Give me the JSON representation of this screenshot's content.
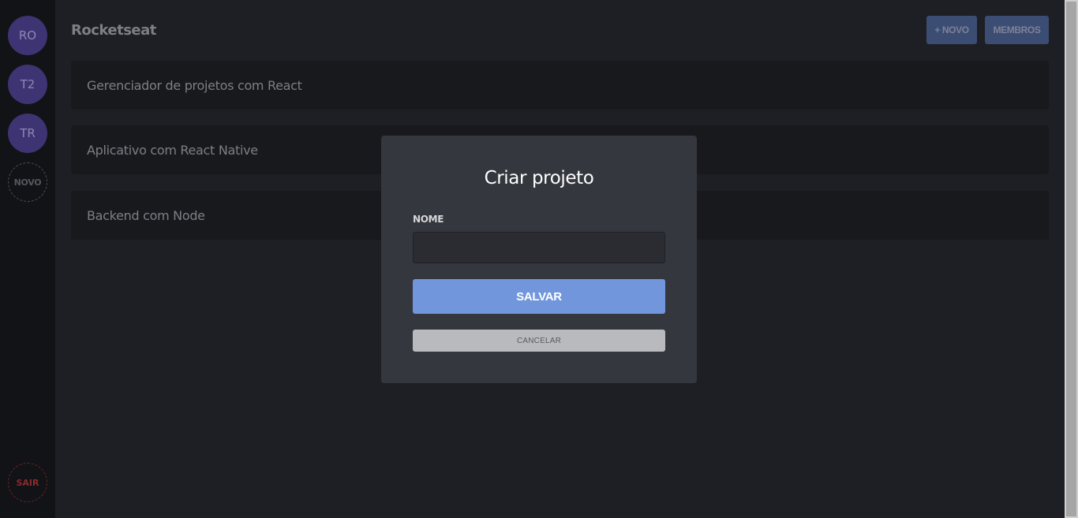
{
  "sidebar": {
    "teams": [
      {
        "initials": "RO"
      },
      {
        "initials": "T2"
      },
      {
        "initials": "TR"
      }
    ],
    "new_team_label": "NOVO",
    "signout_label": "SAIR"
  },
  "header": {
    "team_name": "Rocketseat",
    "new_project_label": "+ NOVO",
    "members_label": "MEMBROS"
  },
  "projects": [
    {
      "title": "Gerenciador de projetos com React"
    },
    {
      "title": "Aplicativo com React Native"
    },
    {
      "title": "Backend com Node"
    }
  ],
  "modal": {
    "title": "Criar projeto",
    "name_label": "NOME",
    "name_value": "",
    "save_label": "SALVAR",
    "cancel_label": "CANCELAR"
  },
  "colors": {
    "accent": "#7196dc",
    "team_avatar": "#3f3473",
    "danger": "#8a2a2c"
  }
}
